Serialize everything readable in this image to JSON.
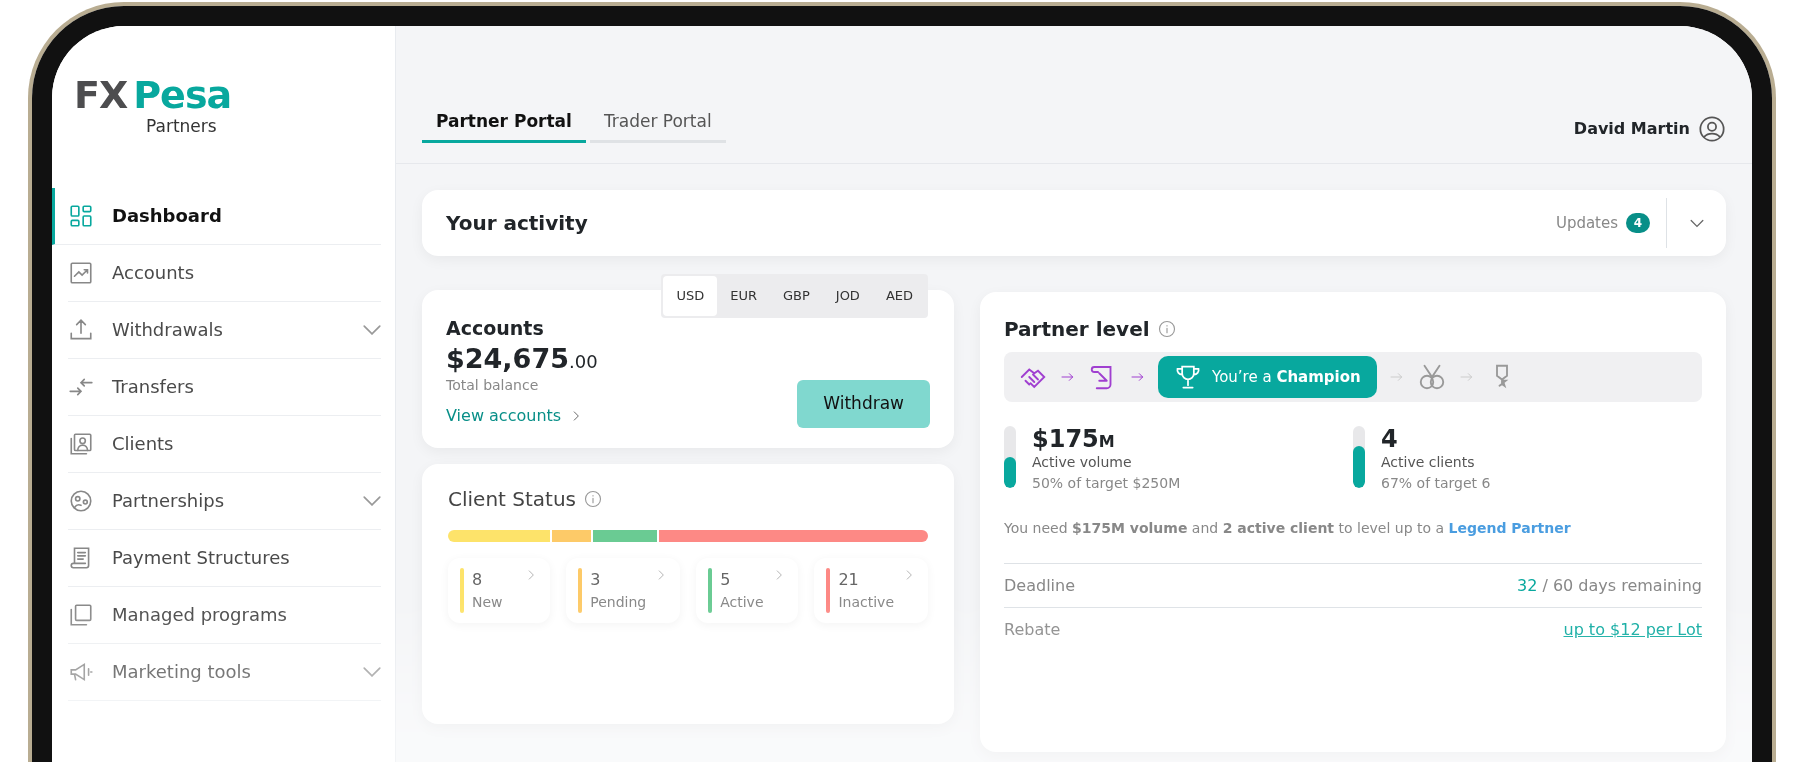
{
  "logo": {
    "mark_left": "FX",
    "mark_right": "Pesa",
    "subtitle": "Partners"
  },
  "sidebar": {
    "items": [
      {
        "label": "Dashboard",
        "selected": true,
        "expandable": false
      },
      {
        "label": "Accounts",
        "selected": false,
        "expandable": false
      },
      {
        "label": "Withdrawals",
        "selected": false,
        "expandable": true
      },
      {
        "label": "Transfers",
        "selected": false,
        "expandable": false
      },
      {
        "label": "Clients",
        "selected": false,
        "expandable": false
      },
      {
        "label": "Partnerships",
        "selected": false,
        "expandable": true
      },
      {
        "label": "Payment Structures",
        "selected": false,
        "expandable": false
      },
      {
        "label": "Managed programs",
        "selected": false,
        "expandable": false
      },
      {
        "label": "Marketing tools",
        "selected": false,
        "expandable": true
      }
    ]
  },
  "tabs": [
    {
      "label": "Partner Portal",
      "selected": true
    },
    {
      "label": "Trader Portal",
      "selected": false
    }
  ],
  "user": {
    "name": "David Martin"
  },
  "activity": {
    "title": "Your activity",
    "updates_label": "Updates",
    "updates_count": "4"
  },
  "accounts": {
    "title": "Accounts",
    "amount": "$24,675",
    "cents": ".00",
    "caption": "Total balance",
    "link": "View accounts",
    "button": "Withdraw",
    "currencies": [
      {
        "label": "USD",
        "selected": true
      },
      {
        "label": "EUR",
        "selected": false
      },
      {
        "label": "GBP",
        "selected": false
      },
      {
        "label": "JOD",
        "selected": false
      },
      {
        "label": "AED",
        "selected": false
      }
    ]
  },
  "client_status": {
    "title": "Client Status",
    "groups": [
      {
        "count": "8",
        "label": "New",
        "color": "#fde36a"
      },
      {
        "count": "3",
        "label": "Pending",
        "color": "#fdca68"
      },
      {
        "count": "5",
        "label": "Active",
        "color": "#6acb93"
      },
      {
        "count": "21",
        "label": "Inactive",
        "color": "#fd8985"
      }
    ]
  },
  "partner_level": {
    "title": "Partner level",
    "steps": [
      {
        "done": true,
        "selected": false
      },
      {
        "done": true,
        "selected": false
      },
      {
        "done": true,
        "selected": true,
        "label": "You’re a **Champion**"
      },
      {
        "done": false,
        "selected": false
      },
      {
        "done": false,
        "selected": false
      }
    ],
    "metrics": [
      {
        "value": "$175",
        "unit": "M",
        "label": "Active volume",
        "target": "50% of target $250M",
        "level": 0.5
      },
      {
        "value": "4",
        "label": "Active clients",
        "target": "67% of target 6",
        "level": 0.67
      }
    ],
    "message": "You need **$175M volume** and **2 active client** to level up to a",
    "message_link": "Legend Partner",
    "details": [
      {
        "label": "Deadline",
        "highlight": "32",
        "value": " / 60 days remaining",
        "kind": "text"
      },
      {
        "label": "Rebate",
        "value": "up to $12 per Lot",
        "kind": "link"
      }
    ]
  }
}
